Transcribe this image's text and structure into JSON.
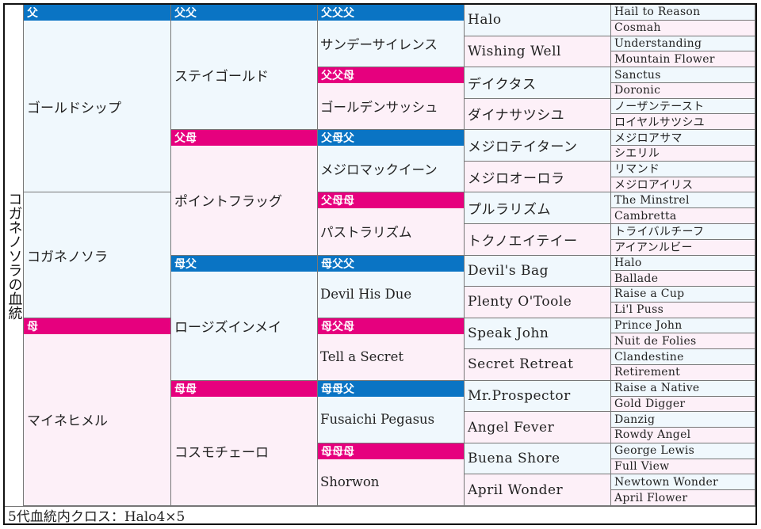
{
  "title": "コガネノソラの血統",
  "footer": "5代血統内クロス：Halo4×5",
  "colors": {
    "sire_header": "#0a74c4",
    "dam_header": "#e6007e",
    "sire_cell": "#f0f8fd",
    "dam_cell": "#fdf0f8"
  },
  "labels": {
    "sire": "父",
    "dam": "母",
    "ss": "父父",
    "sd": "父母",
    "ds": "母父",
    "dd": "母母",
    "sss": "父父父",
    "ssd": "父父母",
    "sds": "父母父",
    "sdd": "父母母",
    "dss": "母父父",
    "dsd": "母父母",
    "dds": "母母父",
    "ddd": "母母母"
  },
  "gen1": [
    "ゴールドシップ",
    "コガネノソラ",
    "マイネヒメル"
  ],
  "gen2": [
    "ステイゴールド",
    "ポイントフラッグ",
    "ロージズインメイ",
    "コスモチェーロ"
  ],
  "gen3": [
    "サンデーサイレンス",
    "ゴールデンサッシュ",
    "メジロマックイーン",
    "パストラリズム",
    "Devil His Due",
    "Tell a Secret",
    "Fusaichi Pegasus",
    "Shorwon"
  ],
  "gen4": [
    "Halo",
    "Wishing Well",
    "デイクタス",
    "ダイナサツシユ",
    "メジロテイターン",
    "メジロオーロラ",
    "プルラリズム",
    "トクノエイテイー",
    "Devil's Bag",
    "Plenty O'Toole",
    "Speak John",
    "Secret Retreat",
    "Mr.Prospector",
    "Angel Fever",
    "Buena Shore",
    "April Wonder"
  ],
  "gen5": [
    "Hail to Reason",
    "Cosmah",
    "Understanding",
    "Mountain Flower",
    "Sanctus",
    "Doronic",
    "ノーザンテースト",
    "ロイヤルサツシユ",
    "メジロアサマ",
    "シエリル",
    "リマンド",
    "メジロアイリス",
    "The Minstrel",
    "Cambretta",
    "トライバルチーフ",
    "アイアンルビー",
    "Halo",
    "Ballade",
    "Raise a Cup",
    "Li'l Puss",
    "Prince John",
    "Nuit de Folies",
    "Clandestine",
    "Retirement",
    "Raise a Native",
    "Gold Digger",
    "Danzig",
    "Rowdy Angel",
    "George Lewis",
    "Full View",
    "Newtown Wonder",
    "April Flower"
  ]
}
